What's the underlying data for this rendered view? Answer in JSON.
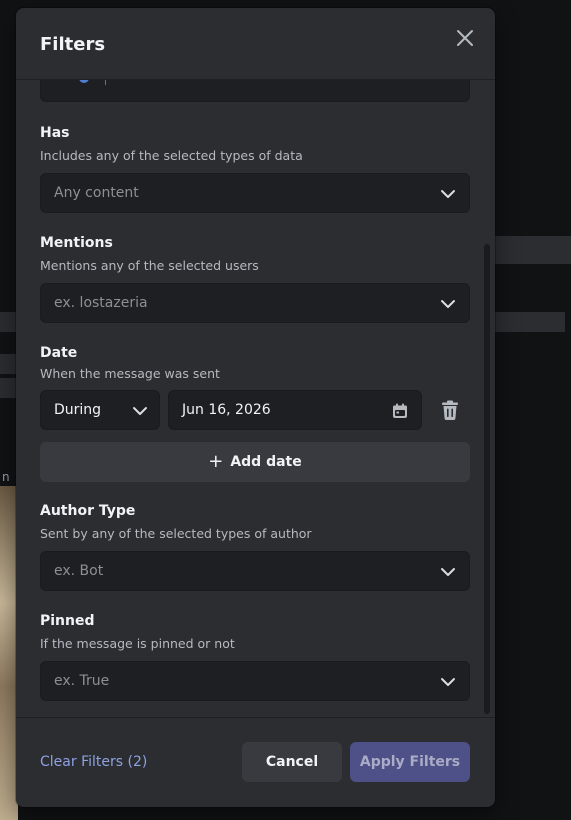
{
  "background": {
    "partial_text": "n"
  },
  "modal": {
    "title": "Filters",
    "close_icon": "close-icon"
  },
  "filters": {
    "has": {
      "label": "Has",
      "description": "Includes any of the selected types of data",
      "placeholder": "Any content"
    },
    "mentions": {
      "label": "Mentions",
      "description": "Mentions any of the selected users",
      "placeholder": "ex. lostazeria"
    },
    "date": {
      "label": "Date",
      "description": "When the message was sent",
      "operator": "During",
      "value": "Jun 16, 2026",
      "add_label": "Add date"
    },
    "author_type": {
      "label": "Author Type",
      "description": "Sent by any of the selected types of author",
      "placeholder": "ex. Bot"
    },
    "pinned": {
      "label": "Pinned",
      "description": "If the message is pinned or not",
      "placeholder": "ex. True"
    }
  },
  "footer": {
    "clear_label": "Clear Filters (2)",
    "cancel_label": "Cancel",
    "apply_label": "Apply Filters"
  },
  "colors": {
    "modal_bg": "#2b2d31",
    "input_bg": "#1e1f22",
    "link": "#8ea1e1",
    "apply_bg": "#4e5187"
  }
}
